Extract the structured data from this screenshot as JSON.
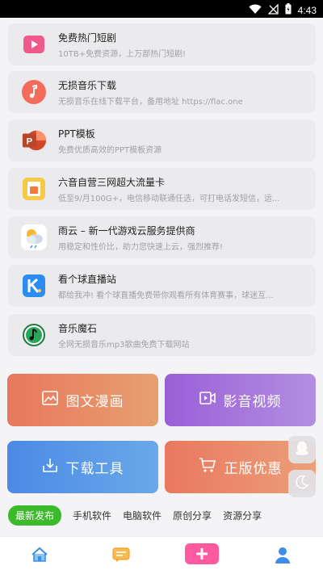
{
  "status": {
    "time": "4:43"
  },
  "items": [
    {
      "title": "免费热门短剧",
      "desc": "10TB+免费资源，上万部热门短剧!",
      "icon": "play-icon"
    },
    {
      "title": "无损音乐下载",
      "desc": "无损音乐在线下载平台，备用地址 https://flac.one",
      "icon": "music-note-icon"
    },
    {
      "title": "PPT模板",
      "desc": "免费优质高效的PPT模板资源",
      "icon": "powerpoint-icon"
    },
    {
      "title": "六音自营三网超大流量卡",
      "desc": "低至9/月100G+，电信移动联通任选，可打电话发短信，运...",
      "icon": "sim-card-icon"
    },
    {
      "title": "雨云 – 新一代游戏云服务提供商",
      "desc": "用稳定和性价比，助力您快速上云，强烈推荐!",
      "icon": "weather-cloud-icon"
    },
    {
      "title": "看个球直播站",
      "desc": "都给我冲! 看个球直播免费带你观看所有体育赛事，球迷互...",
      "icon": "sports-k-icon"
    },
    {
      "title": "音乐魔石",
      "desc": "全网无损音乐mp3歌曲免费下载网站",
      "icon": "music-disc-icon"
    }
  ],
  "categories": [
    {
      "label": "图文漫画",
      "icon": "image-icon",
      "color": "#e77a5a"
    },
    {
      "label": "影音视频",
      "icon": "video-icon",
      "color": "#9a6fd6"
    },
    {
      "label": "下载工具",
      "icon": "download-icon",
      "color": "#4f8fe0"
    },
    {
      "label": "正版优惠",
      "icon": "cart-icon",
      "color": "#e8866a"
    }
  ],
  "tabs": [
    "最新发布",
    "手机软件",
    "电脑软件",
    "原创分享",
    "资源分享"
  ],
  "nav": [
    "home-icon",
    "message-icon",
    "add-icon",
    "user-icon"
  ],
  "colors": {
    "active_tab": "#3cba2c",
    "nav_active": "#ff5aa0",
    "nav_blue": "#3b8de8",
    "nav_orange": "#f2a12e"
  }
}
